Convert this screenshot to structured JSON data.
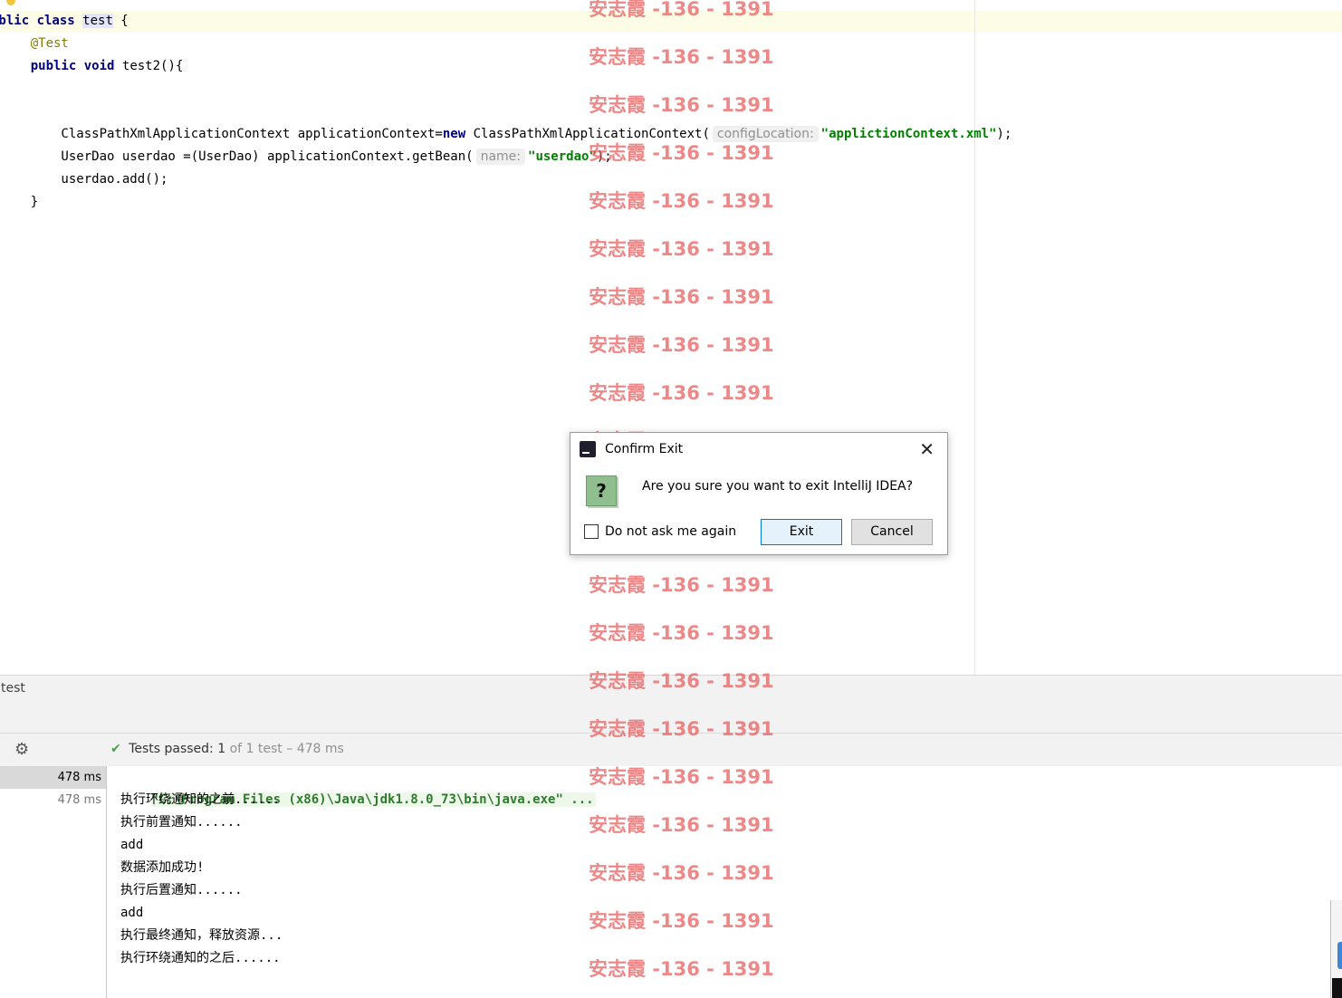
{
  "editor": {
    "lines": [
      {
        "segments": [
          {
            "t": "ublic ",
            "c": "kw"
          },
          {
            "t": "class ",
            "c": "kw"
          },
          {
            "t": "test",
            "c": "cls-hl"
          },
          {
            "t": " {",
            "c": ""
          }
        ]
      },
      {
        "segments": [
          {
            "t": "    ",
            "c": ""
          },
          {
            "t": "@Test",
            "c": "ann"
          }
        ]
      },
      {
        "segments": [
          {
            "t": "    ",
            "c": ""
          },
          {
            "t": "public ",
            "c": "kw"
          },
          {
            "t": "void ",
            "c": "kw"
          },
          {
            "t": "test2(){",
            "c": ""
          }
        ]
      },
      {
        "segments": []
      },
      {
        "segments": []
      },
      {
        "segments": [
          {
            "t": "        ClassPathXmlApplicationContext applicationContext=",
            "c": ""
          },
          {
            "t": "new ",
            "c": "kw"
          },
          {
            "t": "ClassPathXmlApplicationContext(",
            "c": ""
          },
          {
            "t": "configLocation:",
            "c": "hint"
          },
          {
            "t": "\"appliction",
            "c": "str"
          },
          {
            "t": "Context.xml\"",
            "c": "str"
          },
          {
            "t": ");",
            "c": ""
          }
        ]
      },
      {
        "segments": [
          {
            "t": "        UserDao userdao =(UserDao) applicationContext.getBean(",
            "c": ""
          },
          {
            "t": "name:",
            "c": "hint"
          },
          {
            "t": "\"userdao\"",
            "c": "str"
          },
          {
            "t": ");",
            "c": ""
          }
        ]
      },
      {
        "segments": [
          {
            "t": "        userdao.add();",
            "c": ""
          }
        ]
      },
      {
        "segments": [
          {
            "t": "    }",
            "c": ""
          }
        ]
      },
      {
        "segments": [
          {
            "t": "}",
            "c": ""
          }
        ]
      }
    ]
  },
  "run_panel": {
    "tab_label": "test",
    "status": {
      "passed_label": "Tests passed:",
      "passed_count": "1",
      "detail": "of 1 test – 478 ms"
    },
    "tree": [
      {
        "time": "478 ms",
        "selected": true
      },
      {
        "time": "478 ms",
        "selected": false
      }
    ],
    "console": {
      "command": "\"C:\\Program Files (x86)\\Java\\jdk1.8.0_73\\bin\\java.exe\" ...",
      "output": [
        "执行环绕通知的之前......",
        "执行前置通知......",
        "add",
        "数据添加成功!",
        "执行后置通知......",
        "add",
        "执行最终通知，释放资源...",
        "执行环绕通知的之后......"
      ]
    }
  },
  "dialog": {
    "title": "Confirm Exit",
    "message": "Are you sure you want to exit IntelliJ IDEA?",
    "checkbox_label": "Do not ask me again",
    "checkbox_checked": false,
    "exit_label": "Exit",
    "cancel_label": "Cancel",
    "question_icon": "?"
  },
  "watermark": {
    "text": "安志霞 -136 - 1391",
    "count": 21
  },
  "icons": {
    "gear": "⚙",
    "check": "✔",
    "close": "✕"
  }
}
